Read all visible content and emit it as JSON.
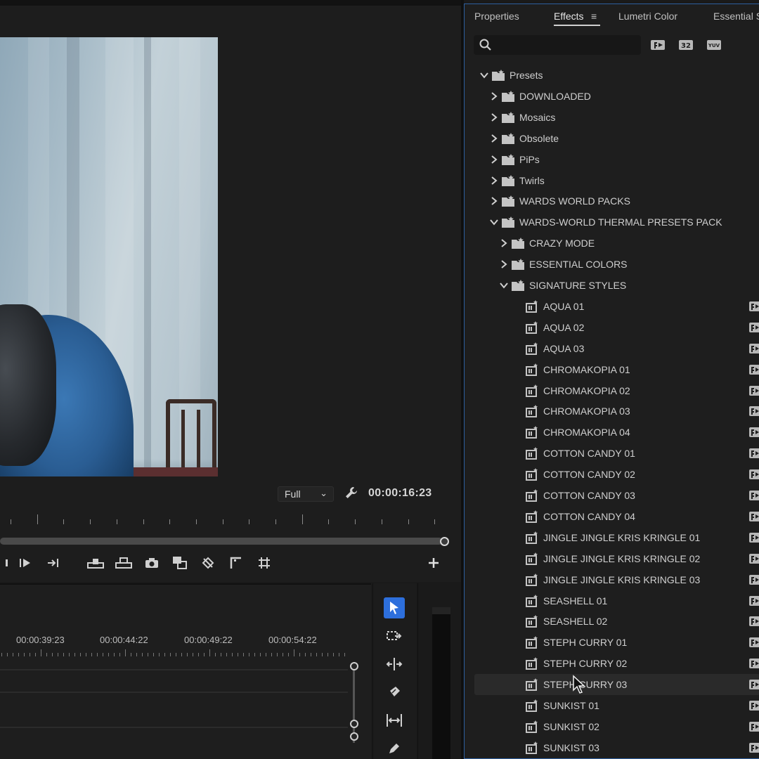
{
  "monitor": {
    "zoom": "Full",
    "timecode": "00:00:16:23"
  },
  "timeline": {
    "timecodes": [
      "00:00:39:23",
      "00:00:44:22",
      "00:00:49:22",
      "00:00:54:22"
    ]
  },
  "effects_panel": {
    "tabs": [
      {
        "label": "Properties",
        "active": false
      },
      {
        "label": "Effects",
        "active": true
      },
      {
        "label": "Lumetri Color",
        "active": false
      },
      {
        "label": "Essential S",
        "active": false
      }
    ],
    "menu_icon": "hamburger-menu-icon",
    "search": {
      "value": "",
      "placeholder": ""
    },
    "filter_buttons": [
      {
        "name": "accelerated-effects-filter",
        "icon": "accelerated-effects-icon"
      },
      {
        "name": "32-bit-filter",
        "icon": "32-bit-icon",
        "text": "32"
      },
      {
        "name": "yuv-filter",
        "icon": "yuv-icon",
        "text": "YUV"
      }
    ],
    "tree": [
      {
        "label": "Presets",
        "level": 0,
        "type": "folder",
        "expanded": true
      },
      {
        "label": "DOWNLOADED",
        "level": 1,
        "type": "folder",
        "expanded": false
      },
      {
        "label": "Mosaics",
        "level": 1,
        "type": "folder",
        "expanded": false
      },
      {
        "label": "Obsolete",
        "level": 1,
        "type": "folder",
        "expanded": false
      },
      {
        "label": "PiPs",
        "level": 1,
        "type": "folder",
        "expanded": false
      },
      {
        "label": "Twirls",
        "level": 1,
        "type": "folder",
        "expanded": false
      },
      {
        "label": "WARDS WORLD PACKS",
        "level": 1,
        "type": "folder",
        "expanded": false
      },
      {
        "label": "WARDS-WORLD THERMAL PRESETS PACK",
        "level": 1,
        "type": "folder",
        "expanded": true
      },
      {
        "label": "CRAZY MODE",
        "level": 2,
        "type": "folder",
        "expanded": false
      },
      {
        "label": "ESSENTIAL COLORS",
        "level": 2,
        "type": "folder",
        "expanded": false
      },
      {
        "label": "SIGNATURE STYLES",
        "level": 2,
        "type": "folder",
        "expanded": true
      },
      {
        "label": "AQUA 01",
        "level": 3,
        "type": "preset"
      },
      {
        "label": "AQUA 02",
        "level": 3,
        "type": "preset"
      },
      {
        "label": "AQUA 03",
        "level": 3,
        "type": "preset"
      },
      {
        "label": "CHROMAKOPIA 01",
        "level": 3,
        "type": "preset"
      },
      {
        "label": "CHROMAKOPIA 02",
        "level": 3,
        "type": "preset"
      },
      {
        "label": "CHROMAKOPIA 03",
        "level": 3,
        "type": "preset"
      },
      {
        "label": "CHROMAKOPIA 04",
        "level": 3,
        "type": "preset"
      },
      {
        "label": "COTTON CANDY 01",
        "level": 3,
        "type": "preset"
      },
      {
        "label": "COTTON CANDY 02",
        "level": 3,
        "type": "preset"
      },
      {
        "label": "COTTON CANDY 03",
        "level": 3,
        "type": "preset"
      },
      {
        "label": "COTTON CANDY 04",
        "level": 3,
        "type": "preset"
      },
      {
        "label": "JINGLE JINGLE KRIS KRINGLE 01",
        "level": 3,
        "type": "preset"
      },
      {
        "label": "JINGLE JINGLE KRIS KRINGLE 02",
        "level": 3,
        "type": "preset"
      },
      {
        "label": "JINGLE JINGLE KRIS KRINGLE 03",
        "level": 3,
        "type": "preset"
      },
      {
        "label": "SEASHELL 01",
        "level": 3,
        "type": "preset"
      },
      {
        "label": "SEASHELL 02",
        "level": 3,
        "type": "preset"
      },
      {
        "label": "STEPH CURRY 01",
        "level": 3,
        "type": "preset"
      },
      {
        "label": "STEPH CURRY 02",
        "level": 3,
        "type": "preset"
      },
      {
        "label": "STEPH CURRY 03",
        "level": 3,
        "type": "preset",
        "selected": true
      },
      {
        "label": "SUNKIST 01",
        "level": 3,
        "type": "preset"
      },
      {
        "label": "SUNKIST 02",
        "level": 3,
        "type": "preset"
      },
      {
        "label": "SUNKIST 03",
        "level": 3,
        "type": "preset"
      }
    ]
  },
  "colors": {
    "accent_blue": "#2d6fdc",
    "panel_focus_border": "#2e5f9f",
    "background": "#1e1e1e"
  }
}
